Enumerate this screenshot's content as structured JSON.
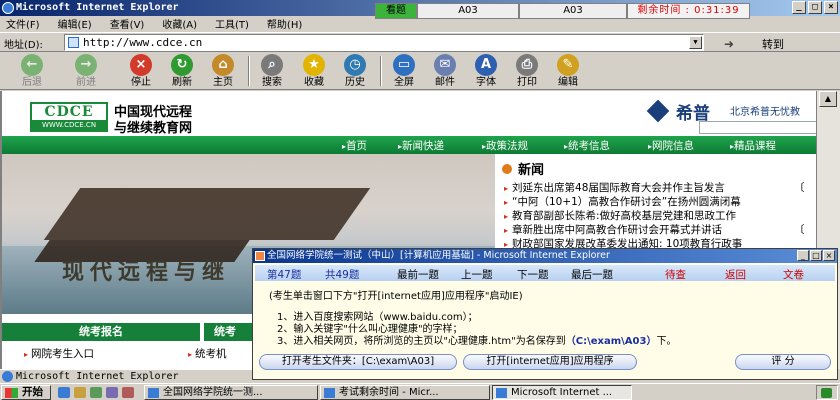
{
  "window": {
    "title": "Microsoft Internet Explorer",
    "min": "_",
    "max": "□",
    "close": "×"
  },
  "exam_status": {
    "seen": "看题",
    "question_a": "A03",
    "question_b": "A03",
    "timer": "剩余时间 : 0:31:39"
  },
  "menu": [
    "文件(F)",
    "编辑(E)",
    "查看(V)",
    "收藏(A)",
    "工具(T)",
    "帮助(H)"
  ],
  "address": {
    "label": "地址(D):",
    "url": "http://www.cdce.cn",
    "go": "转到"
  },
  "toolbar": [
    {
      "label": "后退",
      "icon": "back-icon",
      "color": "#2f9a2f",
      "glyph": "←",
      "disabled": true
    },
    {
      "label": "前进",
      "icon": "forward-icon",
      "color": "#2f9a2f",
      "glyph": "→",
      "disabled": true
    },
    {
      "label": "停止",
      "icon": "stop-icon",
      "color": "#d23a2a",
      "glyph": "×",
      "disabled": false
    },
    {
      "label": "刷新",
      "icon": "refresh-icon",
      "color": "#2f9a2f",
      "glyph": "↻",
      "disabled": false
    },
    {
      "label": "主页",
      "icon": "home-icon",
      "color": "#c48a2a",
      "glyph": "⌂",
      "disabled": false
    },
    {
      "label": "搜索",
      "icon": "search-icon",
      "color": "#7a7a7a",
      "glyph": "⌕",
      "disabled": false
    },
    {
      "label": "收藏",
      "icon": "favorites-icon",
      "color": "#e2b400",
      "glyph": "★",
      "disabled": false
    },
    {
      "label": "历史",
      "icon": "history-icon",
      "color": "#2f7ab0",
      "glyph": "◷",
      "disabled": false
    },
    {
      "label": "全屏",
      "icon": "fullscreen-icon",
      "color": "#2f6fc0",
      "glyph": "▭",
      "disabled": false
    },
    {
      "label": "邮件",
      "icon": "mail-icon",
      "color": "#6a7fb0",
      "glyph": "✉",
      "disabled": false
    },
    {
      "label": "字体",
      "icon": "font-icon",
      "color": "#2f5fb0",
      "glyph": "A",
      "disabled": false
    },
    {
      "label": "打印",
      "icon": "print-icon",
      "color": "#7a7a7a",
      "glyph": "⎙",
      "disabled": false
    },
    {
      "label": "编辑",
      "icon": "edit-icon",
      "color": "#d0a020",
      "glyph": "✎",
      "disabled": false
    }
  ],
  "site": {
    "logo_top": "CDCE",
    "logo_bottom": "WWW.CDCE.CN",
    "title_line1": "中国现代远程",
    "title_line2": "与继续教育网",
    "sponsor_name": "希普",
    "sponsor_desc": "北京希普无忧教",
    "nav": [
      "首页",
      "新闻快递",
      "政策法规",
      "统考信息",
      "网院信息",
      "精品课程"
    ],
    "slogan": "现代远程与继",
    "news_title": "新闻",
    "news": [
      {
        "text": "刘延东出席第48届国际教育大会并作主旨发言",
        "date": "〔"
      },
      {
        "text": "“中阿（10+1）高教合作研讨会”在扬州圆满闭幕",
        "date": ""
      },
      {
        "text": "教育部副部长陈希:做好高校基层党建和思政工作",
        "date": ""
      },
      {
        "text": "章新胜出席中阿高教合作研讨会开幕式并讲话",
        "date": "〔"
      },
      {
        "text": "财政部国家发展改革委发出通知: 10项教育行政事",
        "date": ""
      }
    ],
    "section1": "统考报名",
    "section2": "统考",
    "section1_link": "网院考生入口",
    "section2_link": "统考机"
  },
  "dialog": {
    "title": "全国网络学院统一测试（中山）[计算机应用基础] - Microsoft Internet Explorer",
    "q_no": "第47题",
    "q_total": "共49题",
    "nav": [
      "最前一题",
      "上一题",
      "下一题",
      "最后一题"
    ],
    "pending": "待查",
    "back": "返回",
    "doc": "文卷",
    "instruction": "(考生单击窗口下方\"打开[internet应用]应用程序\"启动IE)",
    "step1": "1、进入百度搜索网站（www.baidu.com）；",
    "step2": "2、输入关键字\"什么叫心理健康\"的字样；",
    "step3_pre": "3、进入相关网页，将所浏览的主页以\"心理健康.htm\"为名保存到",
    "step3_path": "（C:\\exam\\A03）",
    "step3_post": "下。",
    "btn_folder": "打开考生文件夹：[C:\\exam\\A03]",
    "btn_app": "打开[internet应用]应用程序",
    "btn_score": "评 分"
  },
  "ie_status": "Microsoft Internet Explorer",
  "taskbar": {
    "start": "开始",
    "tasks": [
      "全国网络学院统一测...",
      "考试剩余时间 - Micr...",
      "Microsoft Internet ..."
    ]
  }
}
